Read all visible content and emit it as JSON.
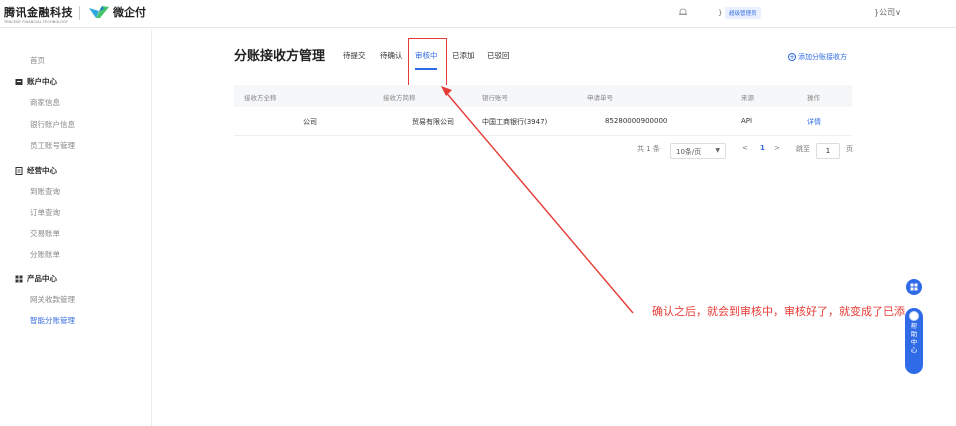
{
  "header": {
    "brand_tencent": "腾讯金融科技",
    "brand_tencent_en": "TENCENT FINANCIAL TECHNOLOGY",
    "brand_product": "微企付",
    "user_name_partial": "}",
    "admin_badge": "超级管理员",
    "company_dropdown": "}公司∨"
  },
  "sidebar": {
    "home": "首页",
    "groups": [
      {
        "label": "账户中心",
        "items": [
          "商家信息",
          "银行账户信息",
          "员工账号管理"
        ]
      },
      {
        "label": "经营中心",
        "items": [
          "到账查询",
          "订单查询",
          "交易账单",
          "分账账单"
        ]
      },
      {
        "label": "产品中心",
        "items": [
          "网关收款管理",
          "智能分账管理"
        ]
      }
    ]
  },
  "main": {
    "title": "分账接收方管理",
    "tabs": [
      "待提交",
      "待确认",
      "审核中",
      "已添加",
      "已驳回"
    ],
    "active_tab": "审核中",
    "add_button": "添加分账接收方",
    "table": {
      "headers": [
        "接收方全称",
        "接收方简称",
        "银行账号",
        "申请单号",
        "来源",
        "操作"
      ],
      "rows": [
        {
          "full_name": "公司",
          "short_name": "贸易有限公司",
          "bank_account": "中国工商银行(3947)",
          "apply_no": "85280000900000",
          "source": "API",
          "action": "详情"
        }
      ]
    },
    "pagination": {
      "total": "共 1 条",
      "page_size": "10条/页",
      "prev": "<",
      "current": "1",
      "next": ">",
      "goto_label": "跳至",
      "goto_value": "1",
      "goto_unit": "页"
    },
    "annotation": "确认之后，就会到审核中，审核好了，就变成了已添"
  },
  "help": {
    "label": "帮助中心"
  },
  "colors": {
    "primary": "#2f6be7",
    "annotation_red": "#e53b36"
  }
}
